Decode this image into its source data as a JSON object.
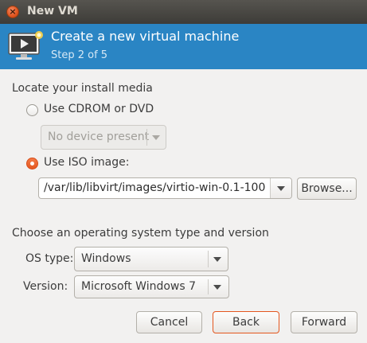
{
  "window": {
    "title": "New VM"
  },
  "header": {
    "title": "Create a new virtual machine",
    "subtitle": "Step 2 of 5"
  },
  "install_media": {
    "section_label": "Locate your install media",
    "cdrom_label": "Use CDROM or DVD",
    "cdrom_selected": false,
    "cdrom_device": "No device present",
    "iso_label": "Use ISO image:",
    "iso_selected": true,
    "iso_path": "/var/lib/libvirt/images/virtio-win-0.1-100",
    "browse_label": "Browse..."
  },
  "os": {
    "section_label": "Choose an operating system type and version",
    "type_label": "OS type:",
    "type_value": "Windows",
    "version_label": "Version:",
    "version_value": "Microsoft Windows 7"
  },
  "buttons": {
    "cancel": "Cancel",
    "back": "Back",
    "forward": "Forward"
  },
  "colors": {
    "header_bg": "#2a85c4",
    "accent": "#e4571f"
  }
}
